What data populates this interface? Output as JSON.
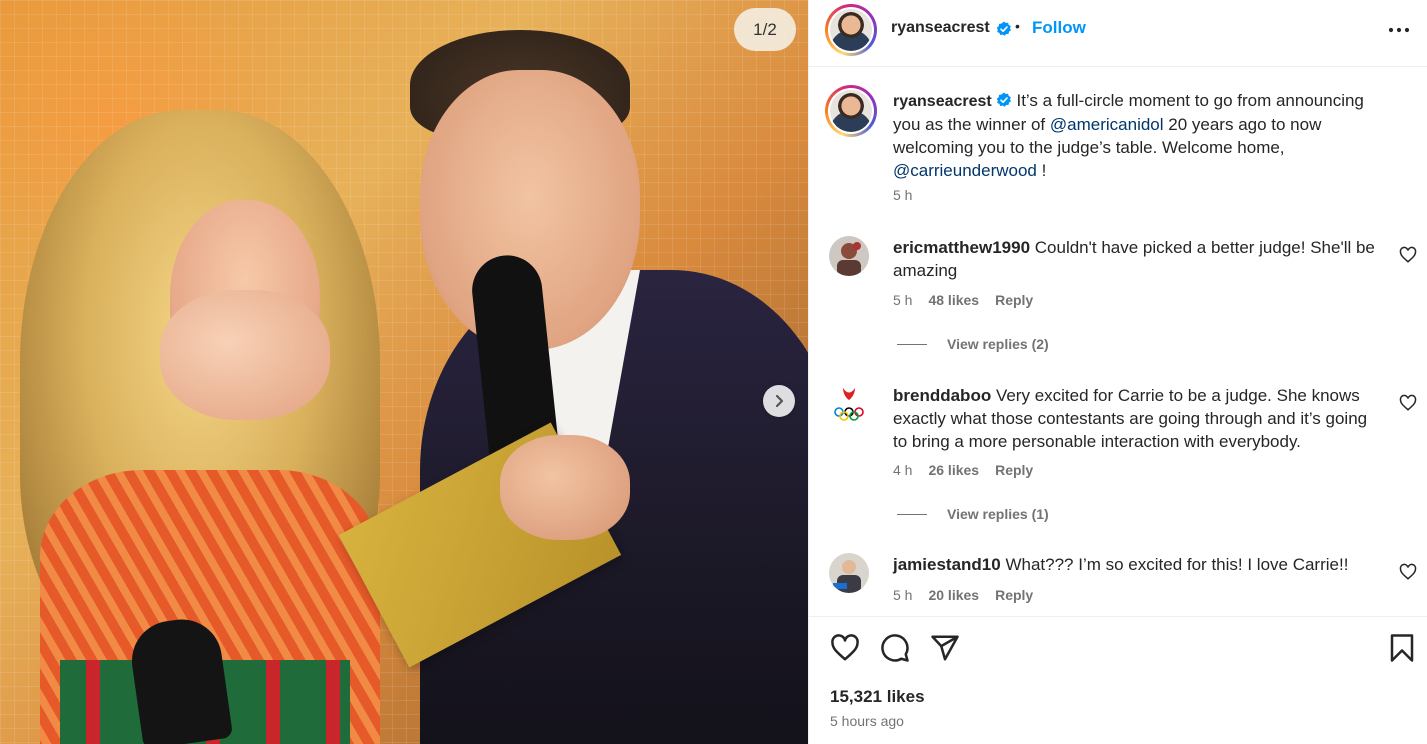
{
  "media": {
    "counter": "1/2",
    "next_icon": "chevron-right-icon"
  },
  "header": {
    "username": "ryanseacrest",
    "verified_icon": "verified-badge-icon",
    "separator": "•",
    "follow_label": "Follow",
    "more_icon": "more-horizontal-icon"
  },
  "caption": {
    "username": "ryanseacrest",
    "text_1": "It’s a full-circle moment to go from announcing you as the winner of",
    "mention_1": "@americanidol",
    "text_2": "20 years ago to now welcoming you to the judge’s table. Welcome home,",
    "mention_2": "@carrieunderwood",
    "text_3": "!",
    "time": "5 h"
  },
  "comments": [
    {
      "username": "ericmatthew1990",
      "text": "Couldn't have picked a better judge! She'll be amazing",
      "time": "5 h",
      "likes": "48 likes",
      "reply_label": "Reply",
      "view_replies": "View replies (2)"
    },
    {
      "username": "brenddaboo",
      "text": "Very excited for Carrie to be a judge. She knows exactly what those contestants are going through and it’s going to bring a more personable interaction with everybody.",
      "time": "4 h",
      "likes": "26 likes",
      "reply_label": "Reply",
      "view_replies": "View replies (1)"
    },
    {
      "username": "jamiestand10",
      "text": "What??? I’m so excited for this! I love Carrie!!",
      "time": "5 h",
      "likes": "20 likes",
      "reply_label": "Reply"
    }
  ],
  "actions": {
    "like_icon": "heart-icon",
    "comment_icon": "comment-icon",
    "share_icon": "send-icon",
    "save_icon": "bookmark-icon",
    "likes_count": "15,321 likes",
    "post_time": "5 hours ago"
  },
  "colors": {
    "link_blue": "#0095f6",
    "mention_blue": "#00376b",
    "muted": "#737373",
    "text": "#262626"
  }
}
